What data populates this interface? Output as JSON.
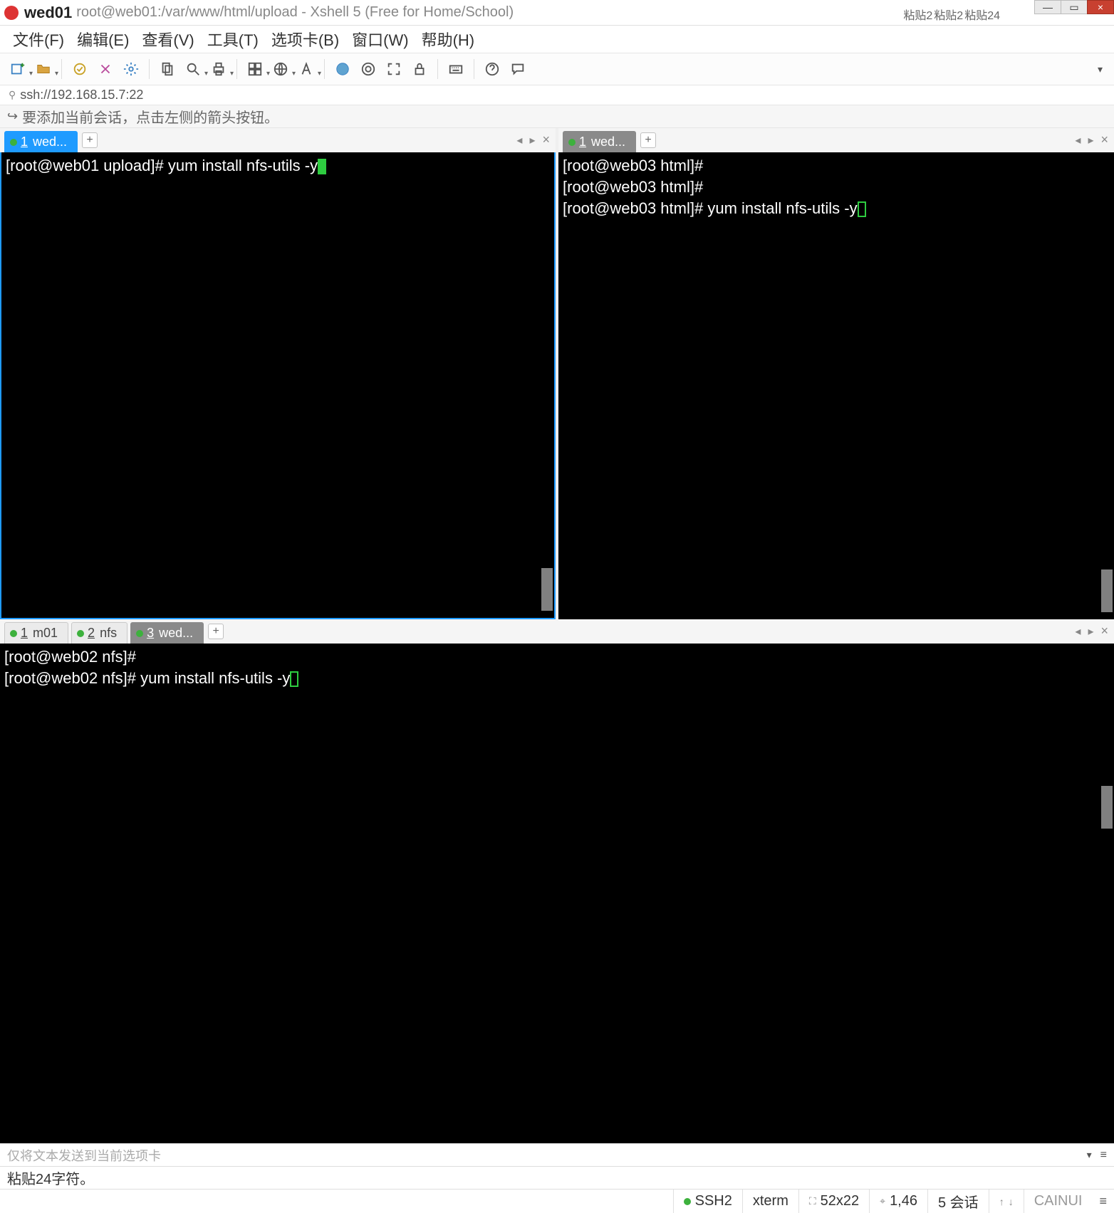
{
  "title": {
    "main": "wed01",
    "sub": "root@web01:/var/www/html/upload - Xshell 5 (Free for Home/School)"
  },
  "watermarks": [
    "粘贴2",
    "粘贴2",
    "粘贴24"
  ],
  "menu": {
    "file": "文件(F)",
    "edit": "编辑(E)",
    "view": "查看(V)",
    "tools": "工具(T)",
    "tabs": "选项卡(B)",
    "window": "窗口(W)",
    "help": "帮助(H)"
  },
  "ssh_url": "ssh://192.168.15.7:22",
  "hint": "要添加当前会话，点击左侧的箭头按钮。",
  "pane_left": {
    "tab_label": "1 wed...",
    "lines": [
      {
        "prompt": "[root@web01 upload]# ",
        "cmd": "yum install nfs-utils -y",
        "cursor": "solid"
      }
    ]
  },
  "pane_right": {
    "tab_label": "1 wed...",
    "lines": [
      {
        "prompt": "[root@web03 html]#",
        "cmd": "",
        "cursor": ""
      },
      {
        "prompt": "[root@web03 html]#",
        "cmd": "",
        "cursor": ""
      },
      {
        "prompt": "[root@web03 html]# ",
        "cmd": "yum install nfs-utils -y",
        "cursor": "hollow"
      }
    ]
  },
  "pane_lower": {
    "tabs": [
      {
        "label_num": "1",
        "label_text": " m01",
        "active": false
      },
      {
        "label_num": "2",
        "label_text": " nfs",
        "active": false
      },
      {
        "label_num": "3",
        "label_text": " wed...",
        "active": true
      }
    ],
    "lines": [
      {
        "prompt": "[root@web02 nfs]#",
        "cmd": "",
        "cursor": ""
      },
      {
        "prompt": "[root@web02 nfs]# ",
        "cmd": "yum install nfs-utils -y",
        "cursor": "hollow"
      }
    ]
  },
  "sendbar_placeholder": "仅将文本发送到当前选项卡",
  "status1": "粘贴24字符。",
  "status2": {
    "ssh": "SSH2",
    "term": "xterm",
    "size": "52x22",
    "pos": "1,46",
    "sessions": "5 会话",
    "user": "CAINUI"
  }
}
